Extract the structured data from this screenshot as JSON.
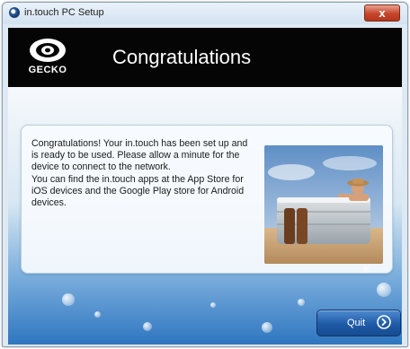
{
  "window": {
    "title": "in.touch PC Setup",
    "close_label": "x"
  },
  "header": {
    "logo_text": "GECKO",
    "title": "Congratulations"
  },
  "message": {
    "line1": "Congratulations! Your in.touch has been set up and is ready to be used. Please allow a minute for the device to connect to the network.",
    "line2": "You can find the in.touch apps at the App Store for iOS devices and the Google Play store for Android devices."
  },
  "buttons": {
    "quit_label": "Quit"
  },
  "colors": {
    "header_bg": "#050505",
    "accent_blue": "#1f5aa6",
    "close_red": "#c6452b"
  }
}
